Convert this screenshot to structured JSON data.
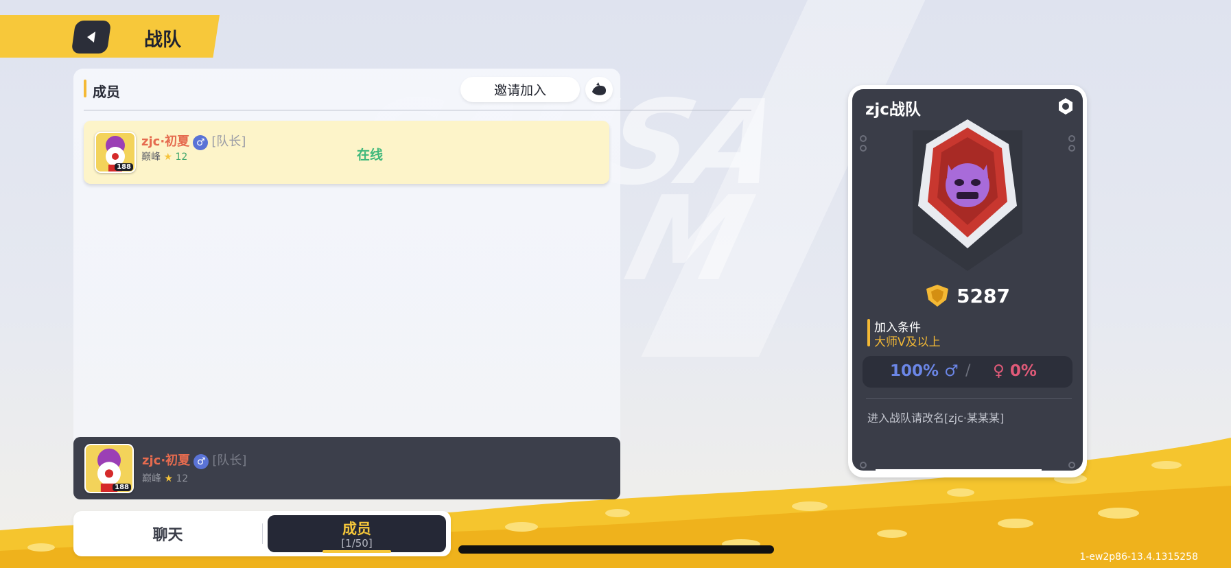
{
  "header": {
    "title": "战队"
  },
  "members_panel": {
    "section_title": "成员",
    "invite_label": "邀请加入"
  },
  "members": [
    {
      "name": "zjc·初夏",
      "gender": "♂",
      "role": "[队长]",
      "rank": "巅峰",
      "rank_stars": "12",
      "level": "188",
      "status": "在线"
    }
  ],
  "self": {
    "name": "zjc·初夏",
    "gender": "♂",
    "role": "[队长]",
    "rank": "巅峰",
    "rank_stars": "12",
    "level": "188"
  },
  "tabs": {
    "chat": "聊天",
    "members": "成员",
    "members_count": "[1/50]",
    "active": "members"
  },
  "team": {
    "name": "zjc战队",
    "score": "5287",
    "join_condition_label": "加入条件",
    "join_condition_value": "大师V及以上",
    "male_pct": "100%",
    "female_pct": "0%",
    "ratio_separator": "/",
    "notice": "进入战队请改名[zjc·某某某]"
  },
  "version": "1-ew2p86-13.4.1315258",
  "colors": {
    "accent": "#f7c83a",
    "online": "#3fb87b",
    "male": "#6b86e6",
    "female": "#e05a78",
    "card_bg": "#3a3d48"
  }
}
